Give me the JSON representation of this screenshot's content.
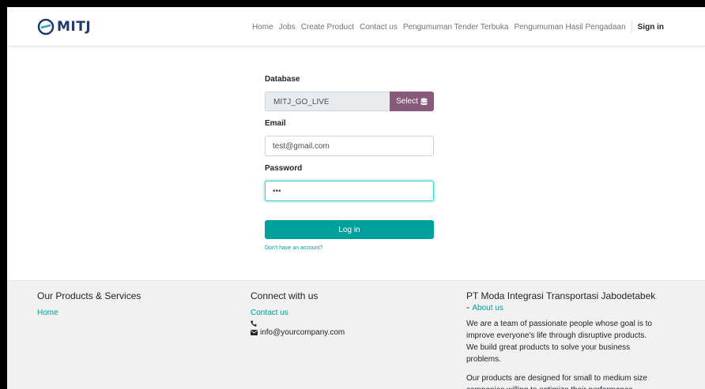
{
  "header": {
    "logo_text": "MITJ",
    "nav": [
      {
        "label": "Home"
      },
      {
        "label": "Jobs"
      },
      {
        "label": "Create Product"
      },
      {
        "label": "Contact us"
      },
      {
        "label": "Pengumuman Tender Terbuka"
      },
      {
        "label": "Pengumuman Hasil Pengadaan"
      }
    ],
    "signin_label": "Sign in"
  },
  "login": {
    "database_label": "Database",
    "database_value": "MITJ_GO_LIVE",
    "select_label": "Select",
    "email_label": "Email",
    "email_value": "test@gmail.com",
    "password_label": "Password",
    "password_value": "•••",
    "login_label": "Log in",
    "signup_link": "Don't have an account?"
  },
  "footer": {
    "products": {
      "title": "Our Products & Services",
      "home_link": "Home"
    },
    "connect": {
      "title": "Connect with us",
      "contact_link": "Contact us",
      "email": "info@yourcompany.com"
    },
    "company": {
      "name": "PT Moda Integrasi Transportasi Jabodetabek",
      "about_link": "About us",
      "desc1": "We are a team of passionate people whose goal is to improve everyone's life through disruptive products. We build great products to solve your business problems.",
      "desc2": "Our products are designed for small to medium size companies willing to optimize their performance."
    }
  },
  "colors": {
    "accent": "#00a09d",
    "select_button": "#875a7b",
    "focus_border": "#3ccfc8",
    "footer_bg": "#f1f1f1"
  }
}
